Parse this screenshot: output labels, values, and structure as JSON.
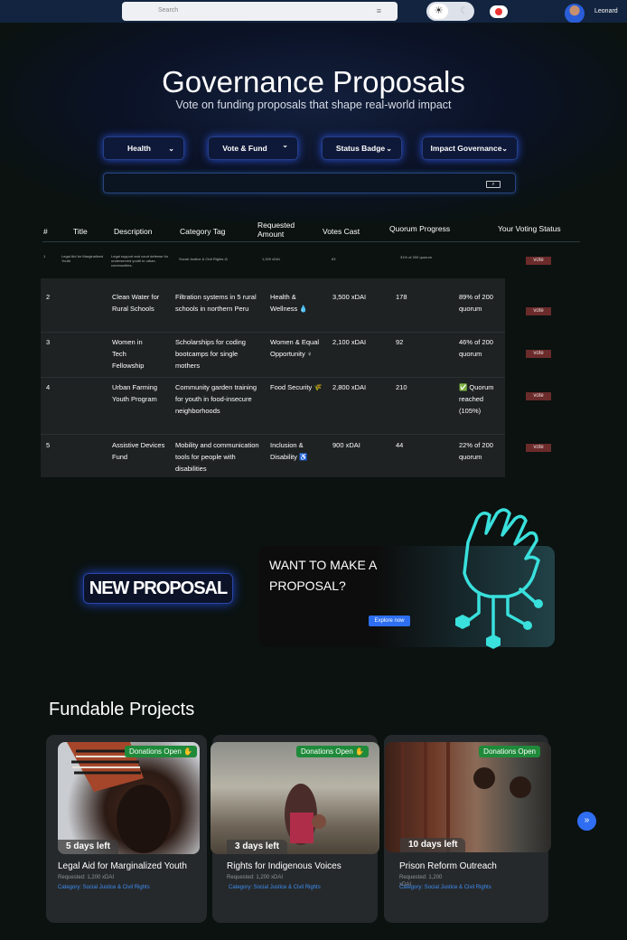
{
  "topbar": {
    "search_placeholder": "Search",
    "filter_icon": "≡",
    "user_name": "Leonard"
  },
  "hero": {
    "title": "Governance Proposals",
    "subtitle": "Vote on funding proposals that shape real-world impact"
  },
  "filters": [
    {
      "label": "Health"
    },
    {
      "label": "Vote & Fund"
    },
    {
      "label": "Status Badge"
    },
    {
      "label": "Impact Governance"
    }
  ],
  "table": {
    "headers": {
      "num": "#",
      "title": "Title",
      "description": "Description",
      "category": "Category Tag",
      "amount": "Requested Amount",
      "votes": "Votes Cast",
      "quorum": "Quorum Progress",
      "status": "Your Voting Status"
    },
    "vote_label": "vote",
    "row1": {
      "num": "1",
      "title": "Legal Aid for Marginalized Youth",
      "description": "Legal support and court defense for underserved youth in urban communities.",
      "category": "Social Justice & Civil Rights ⚖",
      "amount": "1,200 xDAI",
      "votes": "63",
      "quorum": "31% of 200 quorum"
    },
    "rows": [
      {
        "num": "2",
        "title": "Clean Water for Rural Schools",
        "description": "Filtration systems in 5 rural schools in northern Peru",
        "category": "Health & Wellness 💧",
        "amount": "3,500 xDAI",
        "votes": "178",
        "quorum": "89% of 200 quorum"
      },
      {
        "num": "3",
        "title": "Women in Tech Fellowship",
        "description": "Scholarships for coding bootcamps for single mothers",
        "category": "Women & Equal Opportunity ♀",
        "amount": "2,100 xDAI",
        "votes": "92",
        "quorum": "46% of 200 quorum"
      },
      {
        "num": "4",
        "title": "Urban Farming Youth Program",
        "description": "Community garden training for youth in food-insecure neighborhoods",
        "category": "Food Security 🌾",
        "amount": "2,800 xDAI",
        "votes": "210",
        "quorum": "✅ Quorum reached (105%)"
      },
      {
        "num": "5",
        "title": "Assistive Devices Fund",
        "description": "Mobility and communication tools for people with disabilities",
        "category": "Inclusion & Disability ♿",
        "amount": "900 xDAI",
        "votes": "44",
        "quorum": "22% of 200 quorum"
      }
    ]
  },
  "new_proposal": {
    "label": "NEW PROPOSAL"
  },
  "promo": {
    "text": "WANT TO MAKE A PROPOSAL?",
    "button": "Explore now"
  },
  "fundable": {
    "title": "Fundable Projects",
    "cards": [
      {
        "badge": "Donations Open ✋",
        "days": "5 days left",
        "name": "Legal Aid for Marginalized Youth",
        "requested": "Requested: 1,200 xDAI",
        "category": "Category: Social Justice & Civil Rights"
      },
      {
        "badge": "Donations Open ✋",
        "days": "3 days left",
        "name": "Rights for Indigenous Voices",
        "requested": "Requested: 1,200 xDAI",
        "category": "Category: Social Justice & Civil Rights"
      },
      {
        "badge": "Donations Open",
        "days": "10 days left",
        "name": "Prison Reform Outreach",
        "requested": "Requested: 1,200",
        "requested_extra": "xDAI",
        "category": "Category: Social Justice & Civil Rights"
      }
    ]
  },
  "colors": {
    "accent": "#2f6ef3",
    "vote_button": "#6b2b2b",
    "badge_green": "#1f8a3a",
    "background": "#0b1210"
  }
}
